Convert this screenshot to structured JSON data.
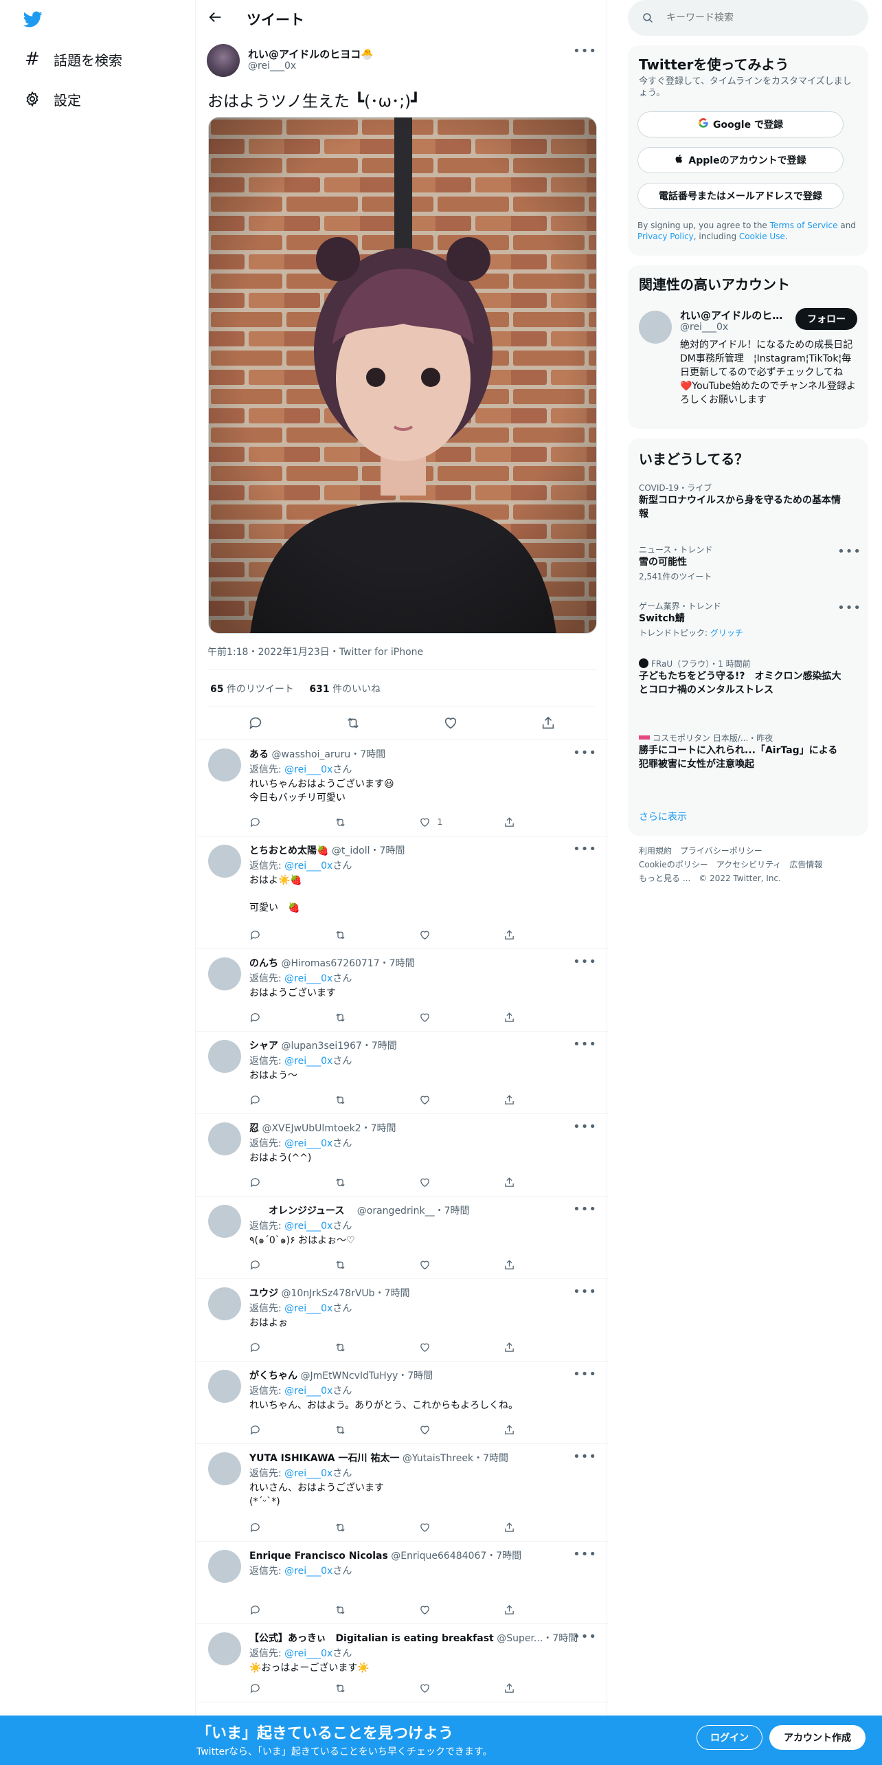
{
  "nav": {
    "explore": "話題を検索",
    "settings": "設定"
  },
  "main": {
    "title": "ツイート"
  },
  "tweet": {
    "author_name": "れい@アイドルのヒヨコ🐣",
    "author_handle": "@rei___0x",
    "text": "おはようツノ生えた ┗(･ω･;)┛",
    "meta": "午前1:18・2022年1月23日・Twitter for iPhone",
    "retweets": "65",
    "retweets_label": "件のリツイート",
    "likes": "631",
    "likes_label": "件のいいね"
  },
  "reply_prefix": "返信先: ",
  "reply_suffix": "さん",
  "reply_to": "@rei___0x",
  "replies": [
    {
      "name": "ある",
      "handle": "@wasshoi_aruru",
      "time": "・7時間",
      "body": "れいちゃんおはようございます😃\n今日もバッチリ可愛い",
      "likes": "1"
    },
    {
      "name": "とちおとめ太陽🍓",
      "handle": "@t_idoll",
      "time": "・7時間",
      "body": "おはよ☀️🍓\n\n可愛い　🍓",
      "likes": ""
    },
    {
      "name": "のんち",
      "handle": "@Hiromas67260717",
      "time": "・7時間",
      "body": "おはようございます",
      "likes": ""
    },
    {
      "name": "シャア",
      "handle": "@lupan3sei1967",
      "time": "・7時間",
      "body": "おはよう〜",
      "likes": ""
    },
    {
      "name": "忍",
      "handle": "@XVEJwUbUlmtoek2",
      "time": "・7時間",
      "body": "おはよう(^^)",
      "likes": ""
    },
    {
      "name": "　　オレンジジュース　",
      "handle": "@orangedrink__",
      "time": "・7時間",
      "body": "٩(๑´0`๑)۶ おはよぉ～♡",
      "likes": ""
    },
    {
      "name": "ユウジ",
      "handle": "@10nJrkSz478rVUb",
      "time": "・7時間",
      "body": "おはよぉ",
      "likes": ""
    },
    {
      "name": "がくちゃん",
      "handle": "@JmEtWNcvIdTuHyy",
      "time": "・7時間",
      "body": "れいちゃん、おはよう。ありがとう、これからもよろしくね。",
      "likes": ""
    },
    {
      "name": "YUTA ISHIKAWA 一石川 祐太一",
      "handle": "@YutaisThreek",
      "time": "・7時間",
      "body": "れいさん、おはようございます\n(*ˊᵕˋ*)",
      "likes": ""
    },
    {
      "name": "Enrique Francisco Nicolas",
      "handle": "@Enrique66484067",
      "time": "・7時間",
      "body": "",
      "likes": ""
    },
    {
      "name": "【公式】あっきぃ　Digitalian is eating breakfast",
      "handle": "@Super...",
      "time": "・7時間",
      "body": "☀️おっはよーございます☀️",
      "likes": ""
    }
  ],
  "search": {
    "placeholder": "キーワード検索"
  },
  "signup": {
    "title": "Twitterを使ってみよう",
    "desc": "今すぐ登録して、タイムラインをカスタマイズしましょう。",
    "google": "Google で登録",
    "apple": "Appleのアカウントで登録",
    "phone": "電話番号またはメールアドレスで登録",
    "terms_1": "By signing up, you agree to the ",
    "terms_link1": "Terms of Service",
    "terms_2": " and ",
    "terms_link2": "Privacy Policy",
    "terms_3": ", including ",
    "terms_link3": "Cookie Use",
    "terms_4": "."
  },
  "related": {
    "title": "関連性の高いアカウント",
    "name": "れい@アイドルのヒヨコ🐣",
    "handle": "@rei___0x",
    "follow": "フォロー",
    "bio": "絶対的アイドル！になるための成長日記　DM事務所管理　¦Instagram¦TikTok¦毎日更新してるので必ずチェックしてね　❤️YouTube始めたのでチャンネル登録よろしくお願いします"
  },
  "trends": {
    "title": "いまどうしてる？",
    "items": [
      {
        "ctx": "COVID-19・ライブ",
        "title": "新型コロナウイルスから身を守るための基本情報",
        "sub": "",
        "sub_link": ""
      },
      {
        "ctx": "ニュース・トレンド",
        "title": "雪の可能性",
        "sub": "2,541件のツイート",
        "sub_link": ""
      },
      {
        "ctx": "ゲーム業界・トレンド",
        "title": "Switch鯖",
        "sub": "トレンドトピック: ",
        "sub_link": "グリッチ"
      },
      {
        "ctx": "FRaU（フラウ）・1 時間前",
        "title": "子どもたちをどう守る!?　オミクロン感染拡大とコロナ禍のメンタルストレス",
        "sub": "",
        "sub_link": ""
      },
      {
        "ctx": "コスモポリタン 日本版/...・昨夜",
        "title": "勝手にコートに入れられ...「AirTag」による犯罪被害に女性が注意喚起",
        "sub": "",
        "sub_link": ""
      }
    ],
    "show_more": "さらに表示"
  },
  "footer": {
    "links": [
      "利用規約",
      "プライバシーポリシー",
      "Cookieのポリシー",
      "アクセシビリティ",
      "広告情報",
      "もっと見る ...",
      "© 2022 Twitter, Inc."
    ]
  },
  "bottombar": {
    "title": "「いま」起きていることを見つけよう",
    "sub": "Twitterなら、「いま」起きていることをいち早くチェックできます。",
    "login": "ログイン",
    "signup": "アカウント作成"
  },
  "colors": {
    "accent": "#1d9bf0",
    "text": "#0f1419",
    "muted": "#536471"
  }
}
